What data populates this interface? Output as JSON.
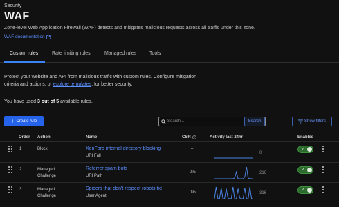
{
  "header": {
    "breadcrumb": "Security",
    "title": "WAF",
    "description": "Zone-level Web Application Firewall (WAF) detects and mitigates malicious requests across all traffic under this zone.",
    "doc_link": "WAF documentation"
  },
  "tabs": [
    {
      "label": "Custom rules",
      "active": true
    },
    {
      "label": "Rate limiting rules",
      "active": false
    },
    {
      "label": "Managed rules",
      "active": false
    },
    {
      "label": "Tools",
      "active": false
    }
  ],
  "intro": {
    "text_before": "Protect your website and API from malicious traffic with custom rules. Configure mitigation criteria and actions, or ",
    "link": "explore templates",
    "text_after": ", for better security."
  },
  "usage": {
    "before": "You have used ",
    "bold": "3 out of 5",
    "after": " available rules."
  },
  "toolbar": {
    "create_label": "Create rule",
    "search_placeholder": "Search...",
    "search_button": "Search",
    "filters_label": "Show filters"
  },
  "table": {
    "headers": {
      "order": "Order",
      "action": "Action",
      "name": "Name",
      "csr": "CSR",
      "activity": "Activity last 24hr",
      "enabled": "Enabled"
    },
    "rows": [
      {
        "order": "1",
        "action": "Block",
        "name": "XenForo internal directory blocking",
        "sub": "URI Full",
        "csr": "–",
        "count": "0",
        "activity": [
          0,
          0,
          0,
          0,
          0,
          0,
          0,
          0,
          0,
          0,
          0,
          0,
          0,
          0,
          0,
          0,
          0,
          0,
          0,
          0,
          0,
          0,
          0,
          0
        ],
        "enabled": true
      },
      {
        "order": "2",
        "action": "Managed Challenge",
        "name": "Referrer spam bots",
        "sub": "URI Path",
        "csr": "0%",
        "count": "216",
        "activity": [
          0,
          0,
          0,
          0,
          0,
          0,
          0,
          0,
          0,
          0,
          0,
          0,
          1,
          8,
          0,
          0,
          0,
          0,
          2,
          14,
          1,
          0,
          0,
          0
        ],
        "enabled": true
      },
      {
        "order": "3",
        "action": "Managed Challenge",
        "name": "Spiders that don't respect robots.txt",
        "sub": "User Agent",
        "csr": "0%",
        "count": "316",
        "activity": [
          0,
          14,
          0,
          0,
          13,
          0,
          0,
          12,
          1,
          0,
          0,
          14,
          0,
          0,
          12,
          1,
          0,
          0,
          13,
          0,
          0,
          14,
          0,
          0
        ],
        "enabled": true
      }
    ]
  },
  "colors": {
    "accent": "#2563eb",
    "link": "#5b8fff",
    "toggle_on": "#2d6a2d",
    "sparkline": "#4a82e0"
  }
}
